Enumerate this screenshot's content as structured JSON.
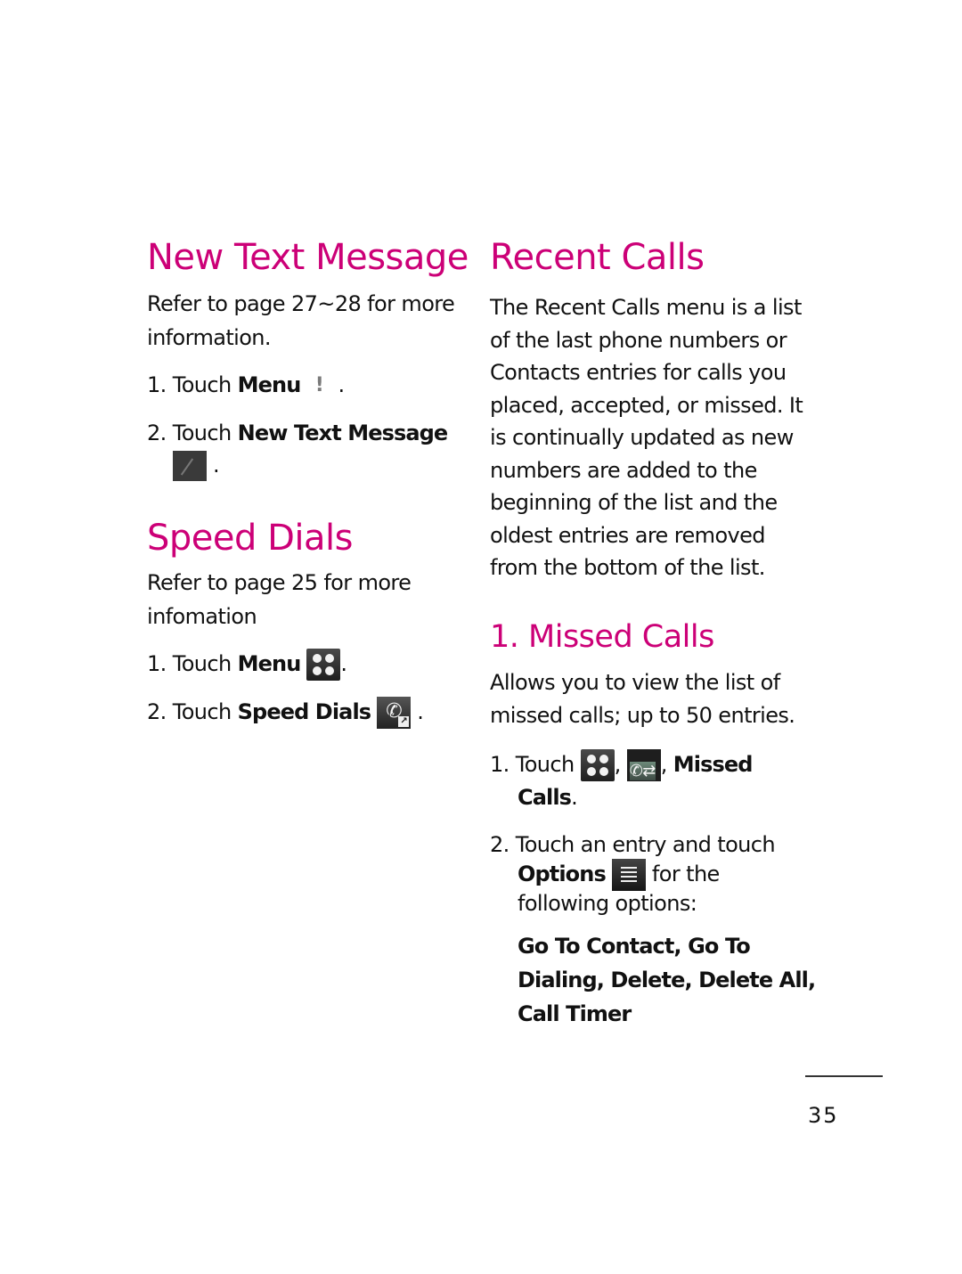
{
  "left_column": {
    "new_text_message": {
      "heading": "New Text Message",
      "intro_line1": "Refer to page 27~28 for more",
      "intro_line2": "information.",
      "steps": [
        {
          "num": "1.",
          "verb": "Touch",
          "target": "Menu",
          "icon": "exclamation-menu-icon",
          "end": "."
        },
        {
          "num": "2.",
          "verb": "Touch",
          "target": "New Text Message",
          "icon": "new-message-note-icon",
          "end": "."
        }
      ]
    },
    "speed_dials": {
      "heading": "Speed Dials",
      "intro_line1": "Refer to page 25 for more",
      "intro_line2": "infomation",
      "steps": [
        {
          "num": "1.",
          "verb": "Touch",
          "target": "Menu",
          "icon": "menu-grid-icon",
          "end": "."
        },
        {
          "num": "2.",
          "verb": "Touch",
          "target": "Speed Dials",
          "icon": "speed-dial-phone-icon",
          "end": "."
        }
      ]
    }
  },
  "right_column": {
    "recent_calls": {
      "heading": "Recent Calls",
      "body_lines": [
        "The Recent Calls menu is a list",
        "of the last phone numbers or",
        "Contacts entries for calls you",
        "placed, accepted, or missed. It",
        "is continually updated as new",
        "numbers are added to the",
        "beginning of the list and the",
        "oldest entries are removed",
        "from the bottom of the list."
      ]
    },
    "missed_calls": {
      "heading": "1. Missed Calls",
      "body_lines": [
        "Allows you to view the list of",
        "missed calls; up to 50 entries."
      ],
      "step1": {
        "num": "1.",
        "verb": "Touch",
        "sep1": ",",
        "sep2": ",",
        "target_line1": "Missed",
        "target_line2": "Calls",
        "end": "."
      },
      "step2": {
        "num": "2.",
        "line1": "Touch an entry and touch",
        "target": "Options",
        "after_icon": "for the",
        "line3": "following options:"
      },
      "options_lines": [
        "Go To Contact, Go To",
        "Dialing, Delete, Delete All,",
        "Call Timer"
      ]
    }
  },
  "footer": {
    "page_number": "35"
  },
  "colors": {
    "heading_accent": "#cc0077",
    "body_text": "#111111"
  }
}
